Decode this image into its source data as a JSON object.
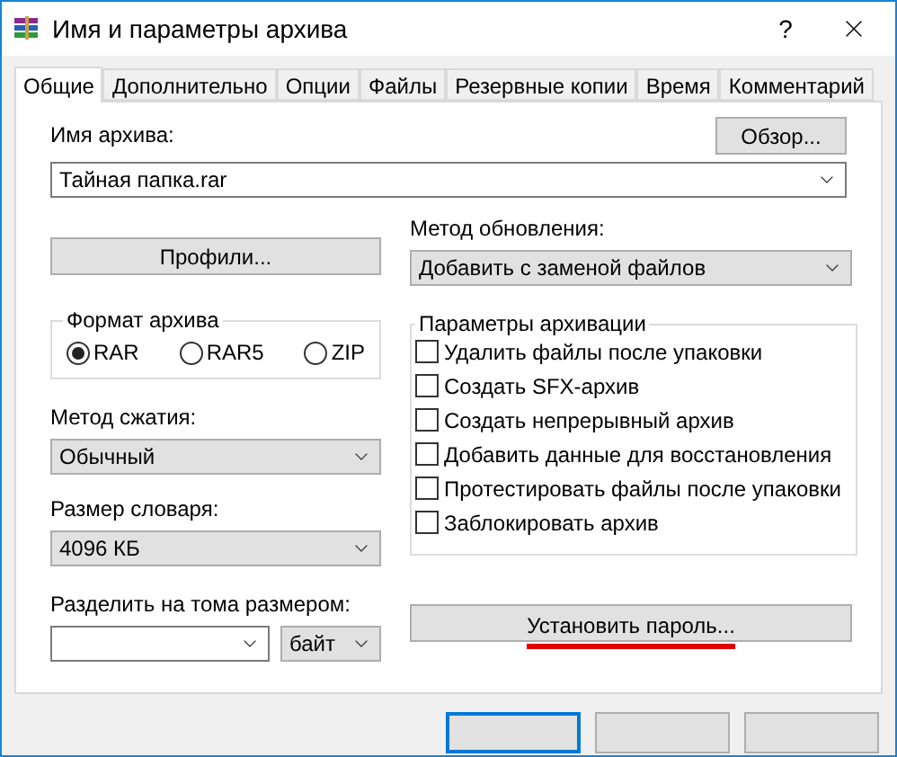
{
  "window": {
    "title": "Имя и параметры архива",
    "help": "?"
  },
  "tabs": [
    {
      "label": "Общие",
      "selected": true
    },
    {
      "label": "Дополнительно",
      "selected": false
    },
    {
      "label": "Опции",
      "selected": false
    },
    {
      "label": "Файлы",
      "selected": false
    },
    {
      "label": "Резервные копии",
      "selected": false
    },
    {
      "label": "Время",
      "selected": false
    },
    {
      "label": "Комментарий",
      "selected": false
    }
  ],
  "archive_name": {
    "label": "Имя архива:",
    "value": "Тайная папка.rar",
    "browse_button": "Обзор..."
  },
  "profiles_button": "Профили...",
  "update_method": {
    "label": "Метод обновления:",
    "value": "Добавить с заменой файлов"
  },
  "archive_format": {
    "title": "Формат архива",
    "options": [
      {
        "label": "RAR",
        "selected": true
      },
      {
        "label": "RAR5",
        "selected": false
      },
      {
        "label": "ZIP",
        "selected": false
      }
    ]
  },
  "compression_method": {
    "label": "Метод сжатия:",
    "value": "Обычный"
  },
  "dictionary_size": {
    "label": "Размер словаря:",
    "value": "4096 КБ"
  },
  "split": {
    "label": "Разделить на тома размером:",
    "unit": "байт"
  },
  "archiving_options": {
    "title": "Параметры архивации",
    "options": [
      {
        "label": "Удалить файлы после упаковки",
        "checked": false
      },
      {
        "label": "Создать SFX-архив",
        "checked": false
      },
      {
        "label": "Создать непрерывный архив",
        "checked": false
      },
      {
        "label": "Добавить данные для восстановления",
        "checked": false
      },
      {
        "label": "Протестировать файлы после упаковки",
        "checked": false
      },
      {
        "label": "Заблокировать архив",
        "checked": false
      }
    ]
  },
  "password_button": {
    "label": "Установить пароль...",
    "underlined": true
  }
}
